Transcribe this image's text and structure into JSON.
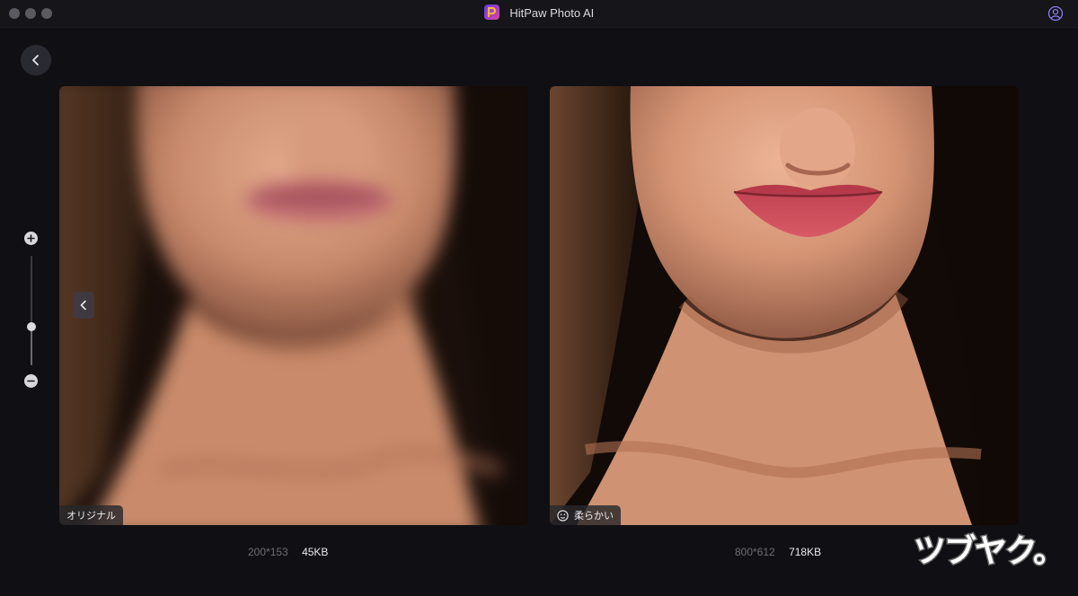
{
  "window": {
    "title": "HitPaw Photo AI"
  },
  "icons": {
    "app_logo": "hitpaw-logo-icon",
    "account": "user-account-icon",
    "back": "chevron-left-icon",
    "zoom_in": "plus-icon",
    "zoom_out": "minus-icon",
    "compare": "chevron-left-icon",
    "model": "face-icon"
  },
  "zoom": {
    "level": 0.35
  },
  "original": {
    "label": "オリジナル",
    "dimensions": "200*153",
    "file_size": "45KB"
  },
  "enhanced": {
    "label": "柔らかい",
    "dimensions": "800*612",
    "file_size": "718KB"
  },
  "watermark": {
    "text": "ツブヤク。"
  },
  "colors": {
    "background": "#101014",
    "accent": "#6c5ce7"
  }
}
